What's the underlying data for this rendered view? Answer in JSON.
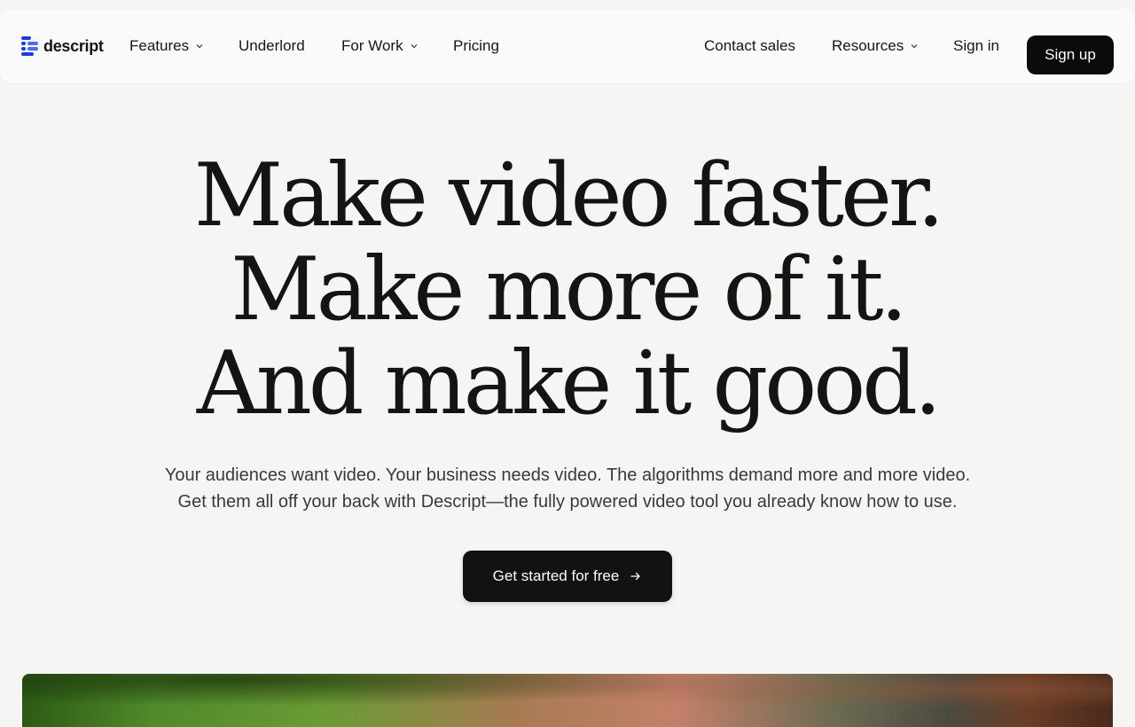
{
  "brand": {
    "name": "descript",
    "accent": "#1c3fd8"
  },
  "nav": {
    "features": "Features",
    "underlord": "Underlord",
    "for_work": "For Work",
    "pricing": "Pricing",
    "contact_sales": "Contact sales",
    "resources": "Resources",
    "sign_in": "Sign in",
    "sign_up": "Sign up"
  },
  "hero": {
    "headline_lines": [
      "Make video faster.",
      "Make more of it.",
      "And make it good."
    ],
    "subtitle_lines": [
      "Your audiences want video. Your business needs video. The algorithms demand more and more video.",
      "Get them all off your back with Descript—the fully powered video tool you already know how to use."
    ],
    "cta_label": "Get started for free",
    "cta_icon": "arrow-right-icon"
  },
  "icons": {
    "dropdown": "chevron-down-icon",
    "logo": "descript-logo-icon"
  }
}
